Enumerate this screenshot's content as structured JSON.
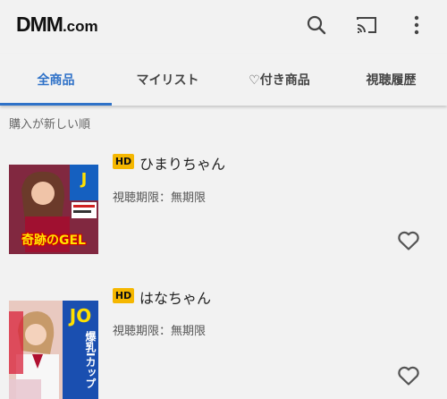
{
  "header": {
    "logo_main": "DMM",
    "logo_suffix": ".com"
  },
  "tabs": [
    {
      "label": "全商品",
      "active": true
    },
    {
      "label": "マイリスト",
      "active": false
    },
    {
      "label": "♡付き商品",
      "active": false
    },
    {
      "label": "視聴履歴",
      "active": false
    }
  ],
  "sort_label": "購入が新しい順",
  "items": [
    {
      "badge": "HD",
      "title": "ひまりちゃん",
      "period": "視聴期限：無期限",
      "thumb_text": "奇跡のGEL"
    },
    {
      "badge": "HD",
      "title": "はなちゃん",
      "period": "視聴期限：無期限",
      "thumb_text": "爆乳Iカップ"
    }
  ],
  "colors": {
    "accent": "#2f72c8",
    "badge": "#f5b700"
  },
  "icons": [
    "search-icon",
    "cast-icon",
    "more-vert-icon",
    "heart-outline-icon"
  ]
}
